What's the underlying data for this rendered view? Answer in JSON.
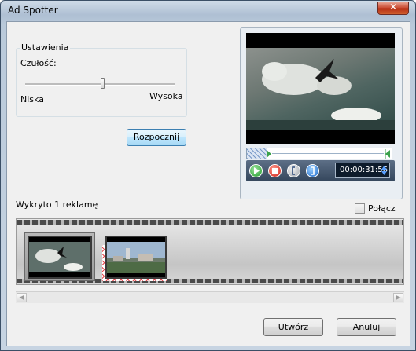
{
  "window": {
    "title": "Ad Spotter",
    "close_label": "✕"
  },
  "settings": {
    "group_title": "Ustawienia",
    "sensitivity_label": "Czułość:",
    "low_label": "Niska",
    "high_label": "Wysoka",
    "sensitivity_value": 0.52
  },
  "start_button": "Rozpocznij",
  "player": {
    "time": "00:00:31:56",
    "icons": [
      "play-icon",
      "stop-icon",
      "mark-in-icon",
      "mark-out-icon"
    ]
  },
  "detected_label": "Wykryto 1 reklamę",
  "merge_checkbox": {
    "label": "Połącz",
    "checked": false
  },
  "filmstrip": {
    "clips": [
      {
        "name": "polar-bear-clip",
        "selected": true
      },
      {
        "name": "city-ad-clip",
        "marked_ad": true
      }
    ]
  },
  "footer": {
    "create_label": "Utwórz",
    "cancel_label": "Anuluj"
  }
}
